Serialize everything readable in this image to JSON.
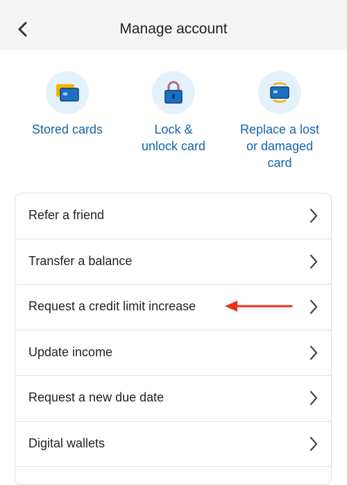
{
  "header": {
    "title": "Manage account"
  },
  "quick_actions": [
    {
      "label_line1": "Stored cards",
      "label_line2": "",
      "label_line3": "",
      "icon": "cards-icon"
    },
    {
      "label_line1": "Lock &",
      "label_line2": "unlock card",
      "label_line3": "",
      "icon": "lock-card-icon"
    },
    {
      "label_line1": "Replace a lost",
      "label_line2": "or damaged",
      "label_line3": "card",
      "icon": "replace-card-icon"
    }
  ],
  "menu": [
    "Refer a friend",
    "Transfer a balance",
    "Request a credit limit increase",
    "Update income",
    "Request a new due date",
    "Digital wallets"
  ],
  "colors": {
    "accent": "#1565a8",
    "annotation": "#e8321e"
  }
}
